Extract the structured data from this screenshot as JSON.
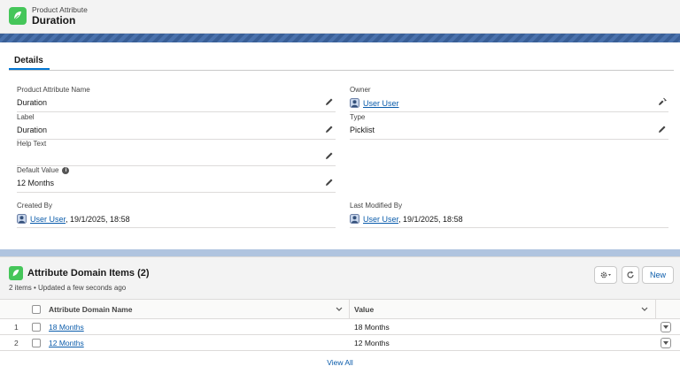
{
  "header": {
    "object_type": "Product Attribute",
    "record_name": "Duration"
  },
  "details": {
    "tab_label": "Details",
    "fields": {
      "product_attribute_name": {
        "label": "Product Attribute Name",
        "value": "Duration"
      },
      "owner": {
        "label": "Owner",
        "value": "User User"
      },
      "label": {
        "label": "Label",
        "value": "Duration"
      },
      "type": {
        "label": "Type",
        "value": "Picklist"
      },
      "help_text": {
        "label": "Help Text",
        "value": ""
      },
      "default_value": {
        "label": "Default Value",
        "value": "12 Months"
      },
      "created_by": {
        "label": "Created By",
        "user": "User User",
        "date": ", 19/1/2025, 18:58"
      },
      "last_modified_by": {
        "label": "Last Modified By",
        "user": "User User",
        "date": ", 19/1/2025, 18:58"
      }
    }
  },
  "related_list": {
    "title": "Attribute Domain Items (2)",
    "subtitle": "2 items • Updated a few seconds ago",
    "new_label": "New",
    "columns": [
      "Attribute Domain Name",
      "Value"
    ],
    "rows": [
      {
        "num": "1",
        "name": "18 Months",
        "value": "18 Months"
      },
      {
        "num": "2",
        "name": "12 Months",
        "value": "12 Months"
      }
    ],
    "view_all_label": "View All"
  }
}
